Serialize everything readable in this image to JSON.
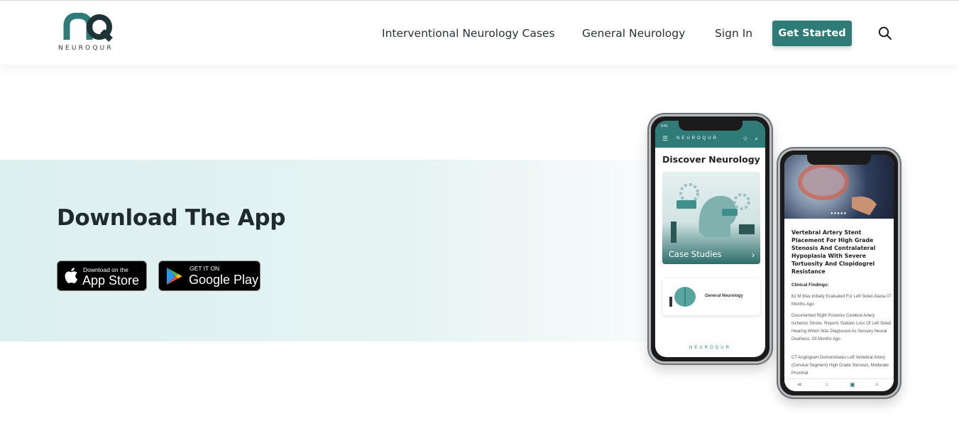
{
  "brand": {
    "name": "NEUROQUR",
    "accent": "#2f7b77"
  },
  "nav": {
    "items": [
      {
        "label": "Interventional Neurology Cases"
      },
      {
        "label": "General Neurology"
      },
      {
        "label": "Sign In"
      }
    ],
    "cta_label": "Get Started",
    "search_icon": "search-icon"
  },
  "hero": {
    "title": "Download The App",
    "app_store": {
      "small": "Download on the",
      "big": "App Store",
      "icon": "apple-icon"
    },
    "google_play": {
      "small": "GET IT ON",
      "big": "Google Play",
      "icon": "google-play-icon"
    }
  },
  "phone_left": {
    "time": "9:41",
    "brand": "NEUROQUR",
    "heading": "Discover Neurology",
    "card1_label": "Case Studies",
    "card2_label": "General Neurology",
    "footer_brand": "NEUROQUR"
  },
  "phone_right": {
    "article_title": "Vertebral Artery Stent Placement For High Grade Stenosis And Contralateral Hypoplasia With Severe Tortuosity And Clopidogrel Resistance",
    "section_heading": "Clinical Findings:",
    "paragraphs": [
      "62 M Was Initially Evaluated For Left Sided Ataxia 07 Months Ago",
      "Documented Right Posterior Cerebral Artery Ischemic Stroke. Reports Sudden Loss Of Left Sided Hearing Which Was Diagnosed As Sensory Neural Deafness. 03 Months Ago.",
      "CT Angiogram Demonstrates Left Vertebral Artery (Cervical Segment) High Grade Stenosis, Moderate Proximal"
    ]
  }
}
